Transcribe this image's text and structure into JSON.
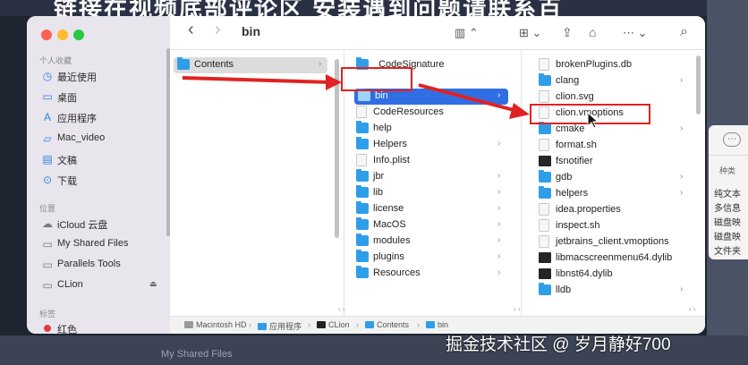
{
  "banner_text": "链接在视频底部评论区 安装遇到问题请联系百",
  "background": {
    "bottom_sidebar_item": "My Shared Files",
    "peek_window": {
      "ellipsis": "⋯",
      "column_header": "种类",
      "rows": [
        "纯文本",
        "多信息",
        "磁盘映",
        "磁盘映",
        "文件夹"
      ]
    }
  },
  "window": {
    "title": "bin",
    "toolbar": {
      "back": "‹",
      "forward": "›",
      "view": "▥ ⌃",
      "group": "⊞ ⌄",
      "share": "⇪",
      "tag": "⌂",
      "more": "⋯ ⌄",
      "search": "⌕"
    },
    "sidebar": {
      "sections": [
        {
          "title": "个人收藏",
          "items": [
            {
              "label": "最近使用",
              "icon": "clock-icon"
            },
            {
              "label": "桌面",
              "icon": "desktop-icon"
            },
            {
              "label": "应用程序",
              "icon": "apps-icon"
            },
            {
              "label": "Mac_video",
              "icon": "folder-icon"
            },
            {
              "label": "文稿",
              "icon": "document-icon"
            },
            {
              "label": "下载",
              "icon": "download-icon"
            }
          ]
        },
        {
          "title": "位置",
          "items": [
            {
              "label": "iCloud 云盘",
              "icon": "cloud-icon"
            },
            {
              "label": "My Shared Files",
              "icon": "drive-icon"
            },
            {
              "label": "Parallels Tools",
              "icon": "drive-icon"
            },
            {
              "label": "CLion",
              "icon": "drive-icon"
            }
          ]
        },
        {
          "title": "标签",
          "items": [
            {
              "label": "红色",
              "icon": "red-tag-icon"
            }
          ]
        }
      ],
      "eject": "⏏"
    },
    "columns": [
      {
        "items": [
          {
            "label": "Contents",
            "type": "folder",
            "has_children": true,
            "selected": "grey"
          }
        ]
      },
      {
        "items": [
          {
            "label": "_CodeSignature",
            "type": "folder",
            "has_children": false
          },
          {
            "label": "bin",
            "type": "folder",
            "has_children": true,
            "selected": "blue"
          },
          {
            "label": "CodeResources",
            "type": "doc",
            "has_children": false
          },
          {
            "label": "help",
            "type": "folder",
            "has_children": false
          },
          {
            "label": "Helpers",
            "type": "folder",
            "has_children": true
          },
          {
            "label": "Info.plist",
            "type": "doc",
            "has_children": false
          },
          {
            "label": "jbr",
            "type": "folder",
            "has_children": true
          },
          {
            "label": "lib",
            "type": "folder",
            "has_children": true
          },
          {
            "label": "license",
            "type": "folder",
            "has_children": true
          },
          {
            "label": "MacOS",
            "type": "folder",
            "has_children": true
          },
          {
            "label": "modules",
            "type": "folder",
            "has_children": true
          },
          {
            "label": "plugins",
            "type": "folder",
            "has_children": true
          },
          {
            "label": "Resources",
            "type": "folder",
            "has_children": true
          }
        ]
      },
      {
        "items": [
          {
            "label": "brokenPlugins.db",
            "type": "doc",
            "has_children": false
          },
          {
            "label": "clang",
            "type": "folder",
            "has_children": true
          },
          {
            "label": "clion.svg",
            "type": "doc",
            "has_children": false
          },
          {
            "label": "clion.vmoptions",
            "type": "doc",
            "has_children": false
          },
          {
            "label": "cmake",
            "type": "folder",
            "has_children": true
          },
          {
            "label": "format.sh",
            "type": "doc",
            "has_children": false
          },
          {
            "label": "fsnotifier",
            "type": "exec",
            "has_children": false
          },
          {
            "label": "gdb",
            "type": "folder",
            "has_children": true
          },
          {
            "label": "helpers",
            "type": "folder",
            "has_children": true
          },
          {
            "label": "idea.properties",
            "type": "doc",
            "has_children": false
          },
          {
            "label": "inspect.sh",
            "type": "doc",
            "has_children": false
          },
          {
            "label": "jetbrains_client.vmoptions",
            "type": "doc",
            "has_children": false
          },
          {
            "label": "libmacscreenmenu64.dylib",
            "type": "exec",
            "has_children": false
          },
          {
            "label": "libnst64.dylib",
            "type": "exec",
            "has_children": false
          },
          {
            "label": "lldb",
            "type": "folder",
            "has_children": true
          }
        ]
      }
    ],
    "column_footer": "‹ ›",
    "path_bar": [
      "Macintosh HD",
      "应用程序",
      "CLion",
      "Contents",
      "bin"
    ],
    "path_separator": "›",
    "chevron": "›"
  },
  "watermark": "掘金技术社区 @ 岁月静好700",
  "colors": {
    "selection_blue": "#2f6fe3",
    "folder_blue": "#2f9ee8",
    "annotation_red": "#e02222"
  }
}
